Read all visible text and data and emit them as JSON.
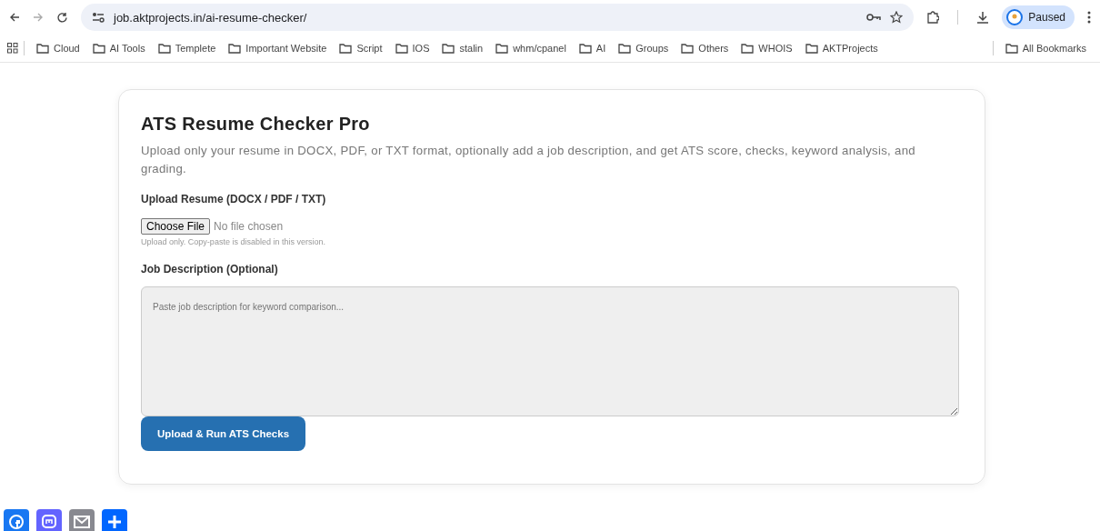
{
  "browser": {
    "url": "job.aktprojects.in/ai-resume-checker/",
    "profile": "Paused",
    "bookmarks": [
      "Cloud",
      "AI Tools",
      "Templete",
      "Important Website",
      "Script",
      "IOS",
      "stalin",
      "whm/cpanel",
      "AI",
      "Groups",
      "Others",
      "WHOIS",
      "AKTProjects"
    ],
    "all_bookmarks": "All Bookmarks"
  },
  "card": {
    "title": "ATS Resume Checker Pro",
    "description": "Upload only your resume in DOCX, PDF, or TXT format, optionally add a job description, and get ATS score, checks, keyword analysis, and grading.",
    "upload_label": "Upload Resume (DOCX / PDF / TXT)",
    "file_button": "Choose File",
    "file_status": "No file chosen",
    "upload_hint": "Upload only. Copy-paste is disabled in this version.",
    "jd_label": "Job Description (Optional)",
    "jd_placeholder": "Paste job description for keyword comparison...",
    "submit": "Upload & Run ATS Checks"
  },
  "share_buttons": [
    {
      "kind": "facebook",
      "color": "#1877f2"
    },
    {
      "kind": "mastodon",
      "color": "#6364ff"
    },
    {
      "kind": "email",
      "color": "#888990"
    },
    {
      "kind": "more",
      "color": "#0166ff"
    }
  ]
}
